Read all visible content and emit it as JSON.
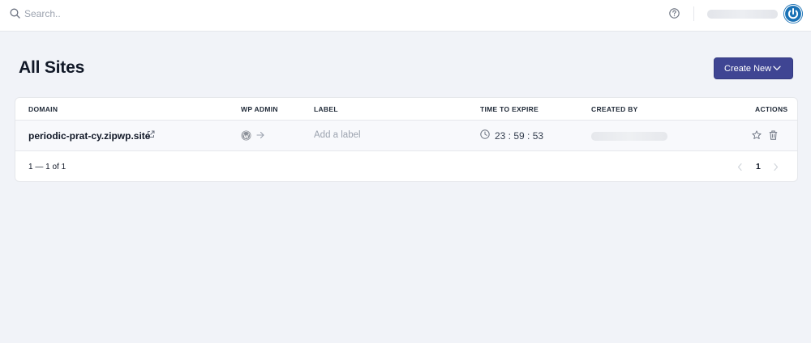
{
  "header": {
    "search_placeholder": "Search..",
    "icons": {
      "search": "search-icon",
      "help": "help-icon",
      "logo": "power-logo-icon"
    },
    "brand_color": "#1a72b6"
  },
  "page": {
    "title": "All Sites",
    "create_button_label": "Create New",
    "accent_color": "#3f4593"
  },
  "table": {
    "columns": [
      "DOMAIN",
      "WP ADMIN",
      "LABEL",
      "TIME TO EXPIRE",
      "CREATED BY",
      "ACTIONS"
    ],
    "rows": [
      {
        "domain": "periodic-prat-cy.zipwp.site",
        "label_placeholder": "Add a label",
        "time_to_expire": "23 : 59 : 53"
      }
    ]
  },
  "pagination": {
    "summary": "1 — 1 of 1",
    "current_page": "1"
  }
}
